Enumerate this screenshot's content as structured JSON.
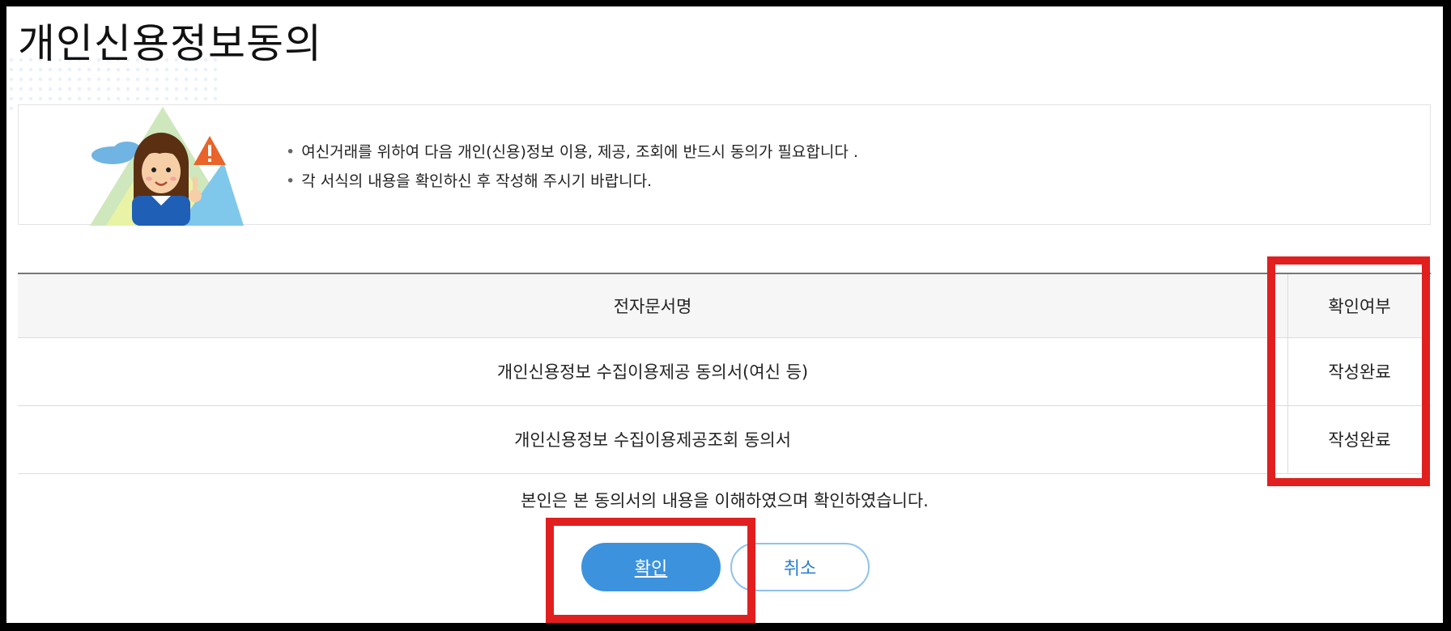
{
  "page": {
    "title": "개인신용정보동의"
  },
  "notice": {
    "lines": [
      "여신거래를 위하여 다음 개인(신용)정보 이용, 제공, 조회에 반드시 동의가 필요합니다 .",
      "각 서식의 내용을 확인하신 후 작성해 주시기 바랍니다."
    ],
    "bullet": "•"
  },
  "table": {
    "headers": {
      "name": "전자문서명",
      "status": "확인여부"
    },
    "rows": [
      {
        "name": "개인신용정보 수집이용제공 동의서(여신 등)",
        "status": "작성완료"
      },
      {
        "name": "개인신용정보 수집이용제공조회 동의서",
        "status": "작성완료"
      }
    ]
  },
  "confirm_text": "본인은 본 동의서의 내용을 이해하였으며 확인하였습니다.",
  "buttons": {
    "ok": "확인",
    "cancel": "취소"
  },
  "colors": {
    "accent": "#3d92dd",
    "highlight": "#e11f1f",
    "warning": "#e8642a"
  }
}
